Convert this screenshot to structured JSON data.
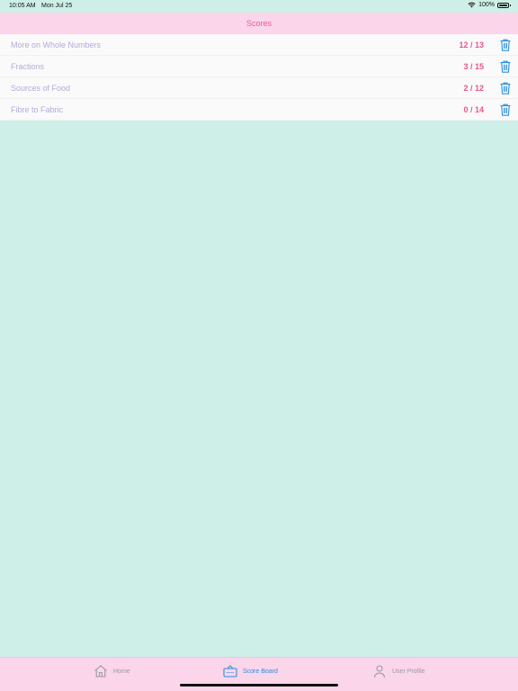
{
  "status": {
    "time": "10:05 AM",
    "date": "Mon Jul 25",
    "battery": "100%",
    "battery_level": 1.0
  },
  "nav": {
    "title": "Scores"
  },
  "scores": [
    {
      "title": "More on Whole Numbers",
      "score": "12 / 13"
    },
    {
      "title": "Fractions",
      "score": "3 / 15"
    },
    {
      "title": "Sources of Food",
      "score": "2 / 12"
    },
    {
      "title": "Fibre to Fabric",
      "score": "0 / 14"
    }
  ],
  "tabs": {
    "home": {
      "label": "Home",
      "icon": "home-icon"
    },
    "scores": {
      "label": "Score Board",
      "icon": "scoreboard-icon",
      "active": true
    },
    "profile": {
      "label": "User Profile",
      "icon": "person-icon"
    }
  },
  "colors": {
    "background": "#cdefe8",
    "nav_bg": "#fbd5ea",
    "accent": "#e8578c",
    "row_title": "#b4aad7",
    "trash": "#2a8fe0"
  }
}
